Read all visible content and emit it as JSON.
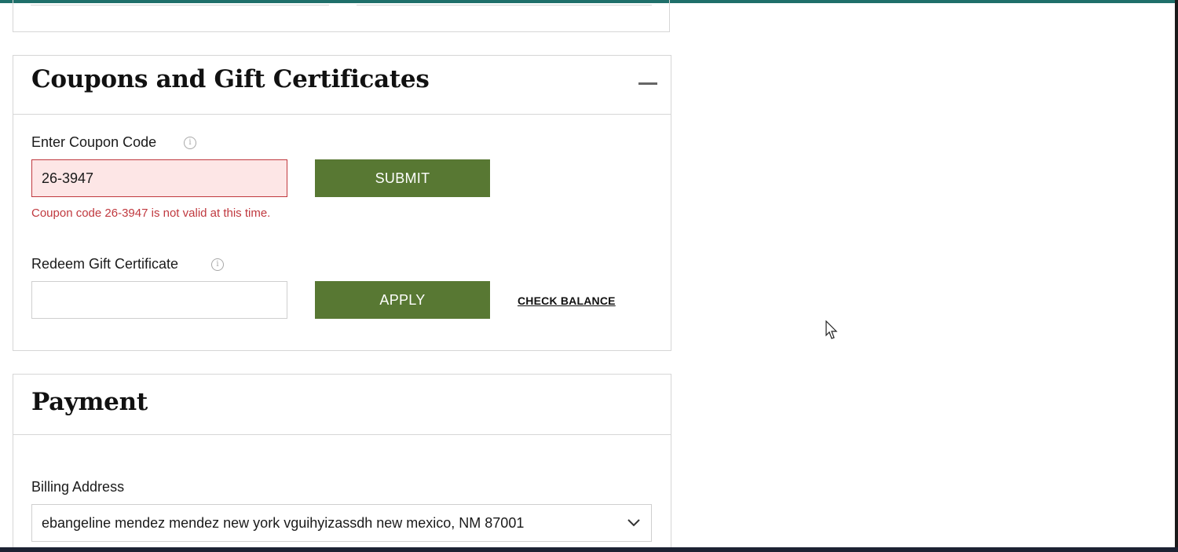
{
  "coupons": {
    "title": "Coupons and Gift Certificates",
    "coupon_label": "Enter Coupon Code",
    "coupon_value": "26-3947",
    "submit_label": "SUBMIT",
    "error_message": "Coupon code 26-3947 is not valid at this time.",
    "gift_label": "Redeem Gift Certificate",
    "gift_value": "",
    "apply_label": "APPLY",
    "check_balance_label": "CHECK BALANCE",
    "info_glyph": "i"
  },
  "payment": {
    "title": "Payment",
    "billing_label": "Billing Address",
    "billing_selected": "ebangeline mendez mendez new york vguihyizassdh new mexico, NM 87001"
  },
  "colors": {
    "accent": "#587833",
    "error": "#c0393f",
    "error_bg": "#fde6e6",
    "top_bar": "#1f6f6a"
  }
}
